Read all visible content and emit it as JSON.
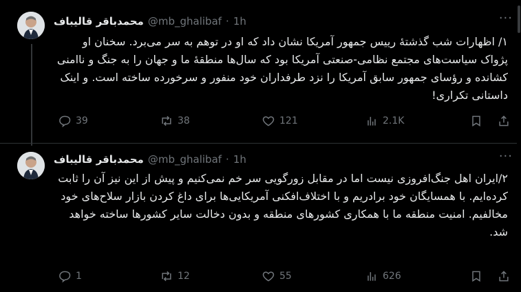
{
  "tweets": [
    {
      "author": "محمدباقر قالیباف",
      "handle": "@mb_ghalibaf",
      "dot": "·",
      "time": "1h",
      "text": "۱/ اظهارات شب گذشتهٔ رییس جمهور آمریکا نشان داد که او در توهم به سر می‌برد. سخنان او پژواک سیاست‌های مجتمع نظامی-صنعتی آمریکا بود که سال‌ها منطقهٔ ما و جهان را به جنگ و ناامنی کشانده و رؤسای جمهور سابق آمریکا را نزد طرفداران خود منفور و سرخورده ساخته است. و اینک داستانی تکراری!",
      "replies": "39",
      "retweets": "38",
      "likes": "121",
      "views": "2.1K"
    },
    {
      "author": "محمدباقر قالیباف",
      "handle": "@mb_ghalibaf",
      "dot": "·",
      "time": "1h",
      "text": "۲/ایران اهل جنگ‌افروزی نیست اما در مقابل زورگویی سر خم نمی‌کنیم و پیش از این نیز آن را ثابت کرده‌ایم. با همسایگان خود برادریم و با اختلاف‌افکنی آمریکایی‌ها برای داغ کردن بازار سلاح‌های خود مخالفیم. امنیت منطقه ما با همکاری کشورهای منطقه و بدون دخالت سایر کشورها ساخته خواهد شد.",
      "replies": "1",
      "retweets": "12",
      "likes": "55",
      "views": "626"
    }
  ],
  "icons": {
    "reply": "reply-icon",
    "retweet": "retweet-icon",
    "like": "heart-icon",
    "views": "analytics-icon",
    "bookmark": "bookmark-icon",
    "share": "share-icon",
    "more": "more-icon"
  },
  "colors": {
    "background": "#000000",
    "text": "#e7e9ea",
    "secondary": "#71767b",
    "divider": "#2f3336"
  }
}
